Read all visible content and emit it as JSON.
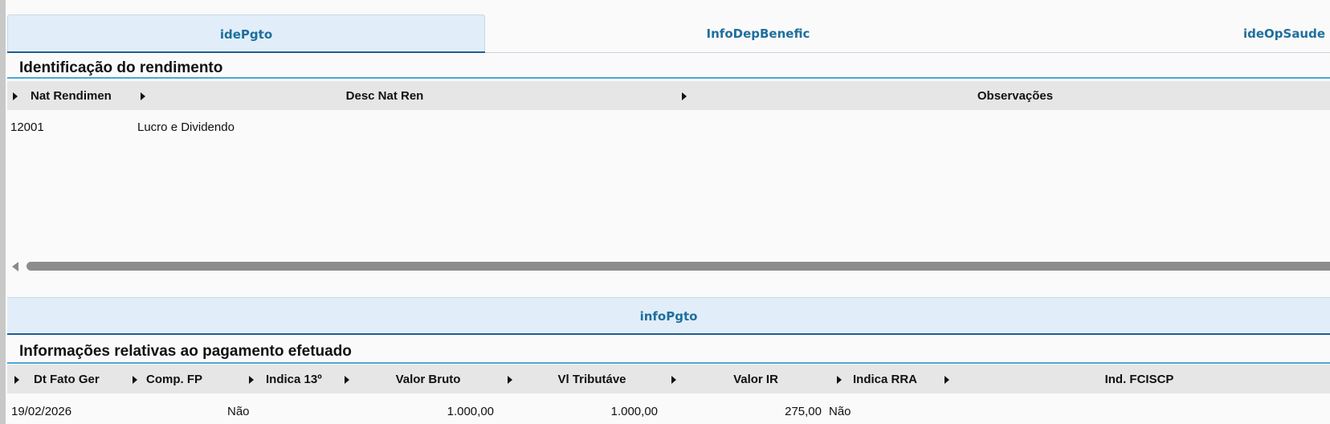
{
  "tabs": [
    {
      "label": "idePgto",
      "active": true
    },
    {
      "label": "InfoDepBenefic",
      "active": false
    },
    {
      "label": "ideOpSaude",
      "active": false
    }
  ],
  "section1": {
    "title": "Identificação do rendimento",
    "columns": [
      "Nat Rendimen",
      "Desc Nat Ren",
      "Observações"
    ],
    "rows": [
      {
        "nat": "12001",
        "desc": "Lucro e Dividendo",
        "obs": ""
      }
    ]
  },
  "bottom_tab": {
    "label": "infoPgto"
  },
  "section2": {
    "title": "Informações relativas ao pagamento efetuado",
    "columns": [
      "Dt Fato Ger",
      "Comp. FP",
      "Indica 13º",
      "Valor Bruto",
      "Vl Tributáve",
      "Valor IR",
      "Indica RRA",
      "Ind. FCISCP"
    ],
    "rows": [
      {
        "dt": "19/02/2026",
        "comp": "",
        "ind13": "Não",
        "bruto": "1.000,00",
        "trib": "1.000,00",
        "ir": "275,00",
        "rra": "Não",
        "fciscp": ""
      }
    ]
  },
  "colors": {
    "accent": "#1f6f9c",
    "tab_bg": "#e1eef9",
    "rule": "#4aa6d8",
    "header_bg": "#e6e6e6"
  }
}
